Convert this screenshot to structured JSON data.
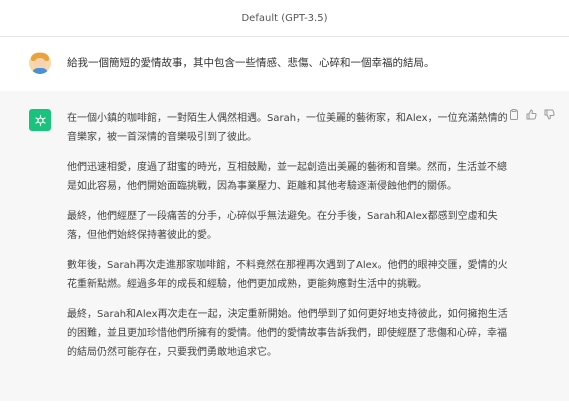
{
  "header": {
    "model_title": "Default (GPT-3.5)"
  },
  "user": {
    "prompt": "給我一個簡短的愛情故事，其中包含一些情感、悲傷、心碎和一個幸福的結局。"
  },
  "assistant": {
    "paragraphs": [
      "在一個小鎮的咖啡館，一對陌生人偶然相遇。Sarah，一位美麗的藝術家，和Alex，一位充滿熱情的音樂家，被一首深情的音樂吸引到了彼此。",
      "他們迅速相愛，度過了甜蜜的時光，互相鼓勵，並一起創造出美麗的藝術和音樂。然而，生活並不總是如此容易，他們開始面臨挑戰，因為事業壓力、距離和其他考驗逐漸侵蝕他們的關係。",
      "最終，他們經歷了一段痛苦的分手，心碎似乎無法避免。在分手後，Sarah和Alex都感到空虛和失落，但他們始終保持著彼此的愛。",
      "數年後，Sarah再次走進那家咖啡館，不料竟然在那裡再次遇到了Alex。他們的眼神交匯，愛情的火花重新點燃。經過多年的成長和經驗，他們更加成熟，更能夠應對生活中的挑戰。",
      "最終，Sarah和Alex再次走在一起，決定重新開始。他們學到了如何更好地支持彼此，如何擁抱生活的困難，並且更加珍惜他們所擁有的愛情。他們的愛情故事告訴我們，即使經歷了悲傷和心碎，幸福的結局仍然可能存在，只要我們勇敢地追求它。"
    ]
  },
  "icons": {
    "user_avatar": "user-avatar-cartoon",
    "assistant_avatar": "openai-logo-icon",
    "copy": "clipboard-icon",
    "thumbs_up": "thumbs-up-icon",
    "thumbs_down": "thumbs-down-icon"
  },
  "colors": {
    "assistant_avatar_bg": "#19c37d",
    "assistant_bg": "#f7f7f8"
  }
}
